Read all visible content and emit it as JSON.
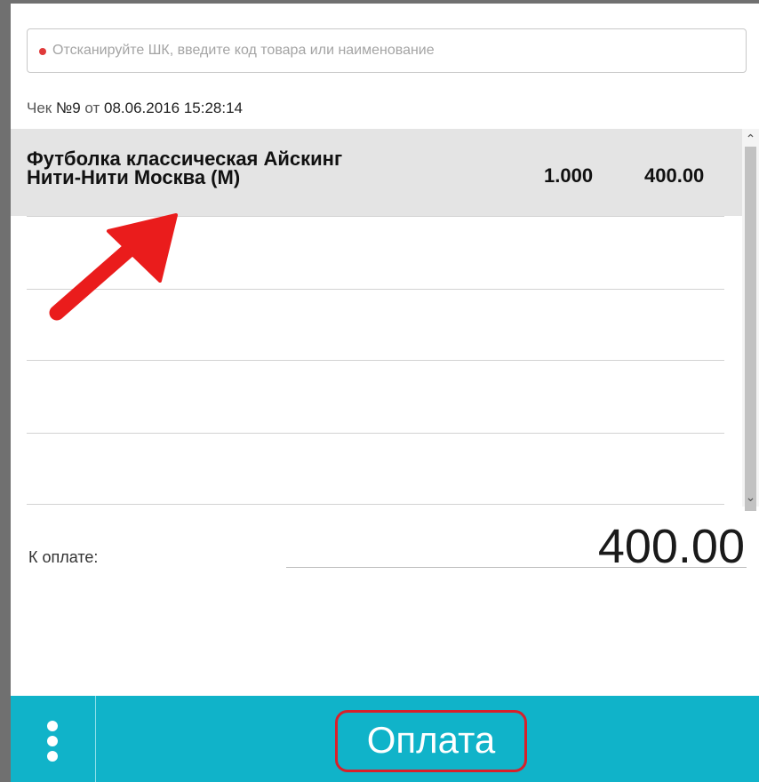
{
  "search": {
    "placeholder": "Отсканируйте ШК, введите код товара или наименование",
    "value": ""
  },
  "receipt": {
    "label": "Чек",
    "number": "№9",
    "date_prefix": "от",
    "datetime": "08.06.2016 15:28:14"
  },
  "items": [
    {
      "name_line1": "Футболка классическая Айскинг",
      "name_line2": "Нити-Нити Москва (М)",
      "quantity": "1.000",
      "price": "400.00",
      "selected": true
    }
  ],
  "payment": {
    "label": "К оплате:",
    "amount": "400.00"
  },
  "bottom_bar": {
    "pay_button": "Оплата",
    "menu_icon": "more-vertical-icon"
  },
  "colors": {
    "accent": "#10b3c9",
    "highlight": "#d8202a",
    "selected_row": "#e4e4e4"
  },
  "annotation": {
    "arrow_icon": "red-arrow-icon"
  }
}
